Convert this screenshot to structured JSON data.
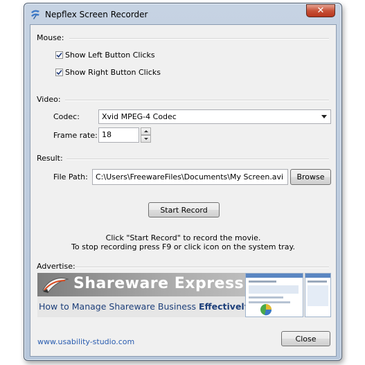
{
  "window": {
    "title": "Nepflex Screen Recorder",
    "close_glyph": "✕"
  },
  "mouse": {
    "label": "Mouse:",
    "show_left": {
      "label": "Show Left Button Clicks",
      "checked": true
    },
    "show_right": {
      "label": "Show Right Button Clicks",
      "checked": true
    }
  },
  "video": {
    "label": "Video:",
    "codec_label": "Codec:",
    "codec_value": "Xvid MPEG-4 Codec",
    "frame_rate_label": "Frame rate:",
    "frame_rate_value": "18"
  },
  "result": {
    "label": "Result:",
    "file_path_label": "File Path:",
    "file_path_value": "C:\\Users\\FreewareFiles\\Documents\\My Screen.avi",
    "browse_label": "Browse"
  },
  "actions": {
    "start_label": "Start Record",
    "instruction_line1": "Click \"Start Record\" to record the movie.",
    "instruction_line2": "To stop recording press F9 or click icon on the system tray."
  },
  "advertise": {
    "label": "Advertise:",
    "banner_title": "Shareware Express",
    "banner_subtitle": "How to Manage Shareware Business",
    "banner_subtitle_bold": "Effectively"
  },
  "footer": {
    "link": "www.usability-studio.com",
    "close_label": "Close"
  },
  "colors": {
    "link": "#2a5db0",
    "banner_title": "#ffffff",
    "banner_subtitle": "#1d3f7a"
  }
}
